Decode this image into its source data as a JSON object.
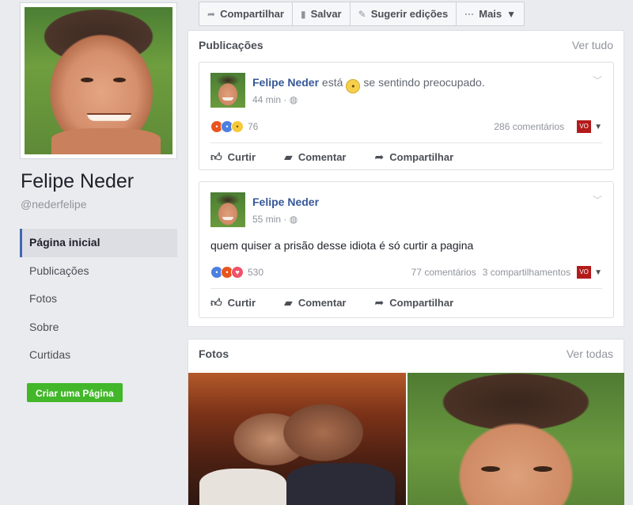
{
  "profile": {
    "name": "Felipe Neder",
    "handle": "@nederfelipe"
  },
  "nav": [
    {
      "label": "Página inicial",
      "active": true
    },
    {
      "label": "Publicações"
    },
    {
      "label": "Fotos"
    },
    {
      "label": "Sobre"
    },
    {
      "label": "Curtidas"
    }
  ],
  "create_page_label": "Criar uma Página",
  "actionbar": {
    "share": "Compartilhar",
    "save": "Salvar",
    "suggest": "Sugerir edições",
    "more": "Mais"
  },
  "publications": {
    "title": "Publicações",
    "see_all": "Ver tudo",
    "posts": [
      {
        "author": "Felipe Neder",
        "feeling_prefix": "está",
        "feeling": "se sentindo preocupado.",
        "time": "44 min",
        "reactions": "76",
        "comments": "286 comentários",
        "shares": "",
        "text": "",
        "actions": {
          "like": "Curtir",
          "comment": "Comentar",
          "share": "Compartilhar"
        }
      },
      {
        "author": "Felipe Neder",
        "time": "55 min",
        "text": "quem quiser a prisão desse idiota é só curtir a pagina",
        "reactions": "530",
        "comments": "77 comentários",
        "shares": "3 compartilhamentos",
        "actions": {
          "like": "Curtir",
          "comment": "Comentar",
          "share": "Compartilhar"
        }
      }
    ]
  },
  "photos": {
    "title": "Fotos",
    "see_all": "Ver todas"
  },
  "colors": {
    "link_blue": "#365899",
    "create_green": "#42b72a",
    "nav_active_border": "#4267b2"
  }
}
